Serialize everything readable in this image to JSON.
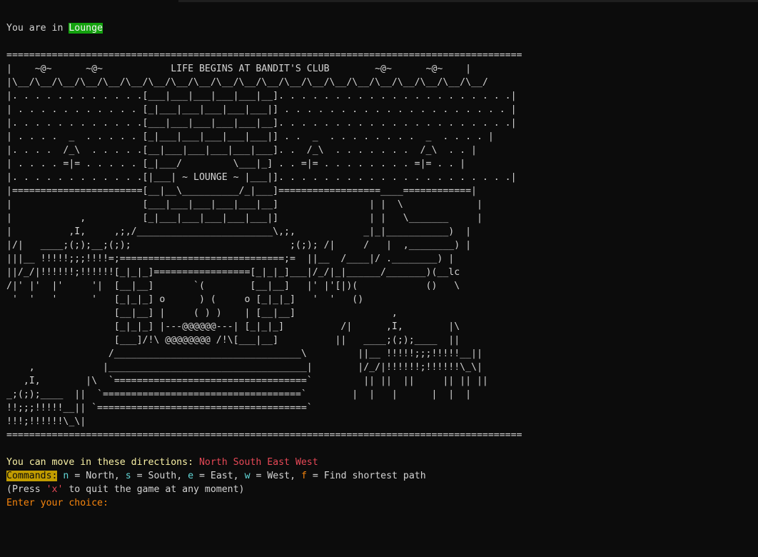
{
  "terminal": {
    "location": {
      "prefix": "You are in ",
      "room": "Lounge"
    },
    "ascii_art": [
      "===========================================================================================",
      "|    ~@~      ~@~            LIFE BEGINS AT BANDIT'S CLUB        ~@~      ~@~    |",
      "|\\__/\\__/\\__/\\__/\\__/\\__/\\__/\\__/\\__/\\__/\\__/\\__/\\__/\\__/\\__/\\__/\\__/\\__/\\__/\\__/\\__/",
      "|. . . . . . . . . . . .[___|___|___|___|___|__]. . . . . . . . . . . . . . . . . . . . .|",
      "| . . . . . . . . . . . [_|___|___|___|___|___|] . . . . . . . . . . . . . . . . . . . . |",
      "|. . . . . . . . . . . .[___|___|___|___|___|__]. . . . . . . . . . . . . . . . . . . . .|",
      "| . . . .  _  . . . . . [_|___|___|___|___|___|] . .  _  . . . . . . . .  _  . . . . |",
      "|. . . .  /_\\  . . . . .[__|___|___|___|___|___]. .  /_\\  . . . . . . .  /_\\  . . |",
      "| . . . . =|= . . . . . [_|___/         \\___|_] . . =|= . . . . . . . . =|= . . |",
      "|. . . . . . . . . . . .[|___| ~ LOUNGE ~ |___|]. . . . . . . . . . . . . . . . . . . . .|",
      "|=======================[__|__\\__________/_|___]==================____============|",
      "|                       [___|___|___|___|___|__]                | |  \\             |",
      "|            ,          [_|___|___|___|___|___|]                | |   \\_______     |",
      "|          ,I,     ,;,/________________________\\,;,            _|_|___________)  |",
      "|/|   ____;(;);__;(;);                            ;(;); /|     /   |  ,________) |",
      "|||__ !!!!!;;;!!!!=;=============================;=  ||__  /____|/ .________) |",
      "||/_/|!!!!!!;!!!!!![_|_|_]=================[_|_|_]___|/_/|_|______/_______)(__lc",
      "/|' |'  |'     '|  [__|__]       `(        [__|__]   |' |'[|)(            ()   \\",
      " '  '   '      '   [_|_|_] o      ) (     o [_|_|_]   '  '   ()",
      "                   [__|__] |     ( ) )    | [__|__]                 ,",
      "                   [_|_|_] |---@@@@@@---| [_|_|_]          /|      ,I,        |\\",
      "                   [___]/!\\ @@@@@@@@ /!\\[___|__]          ||   ____;(;);____  ||",
      "                  /_________________________________\\         ||__ !!!!!;;;!!!!!__||",
      "    ,            |___________________________________|        |/_/|!!!!!!;!!!!!!\\_\\|",
      "   ,I,        |\\  `==================================`         || ||  ||     || || ||",
      "_;(;);____  ||  `===================================`        |  |   |      |  |  |",
      "!!;;;!!!!!__|| `=====================================`",
      "!!!;!!!!!!\\_\\|",
      "==========================================================================================="
    ],
    "moves": {
      "prefix": "You can move in these directions: ",
      "directions": "North South East West"
    },
    "commands": {
      "label": "Commands:",
      "n_key": "n",
      "n_text": " = North, ",
      "s_key": "s",
      "s_text": " = South, ",
      "e_key": "e",
      "e_text": " = East, ",
      "w_key": "w",
      "w_text": " = West, ",
      "f_key": "f",
      "f_text": " = Find shortest path"
    },
    "quit": {
      "open": "(Press ",
      "key": "'x'",
      "close": " to quit the game at any moment)"
    },
    "prompt": "Enter your choice:"
  }
}
